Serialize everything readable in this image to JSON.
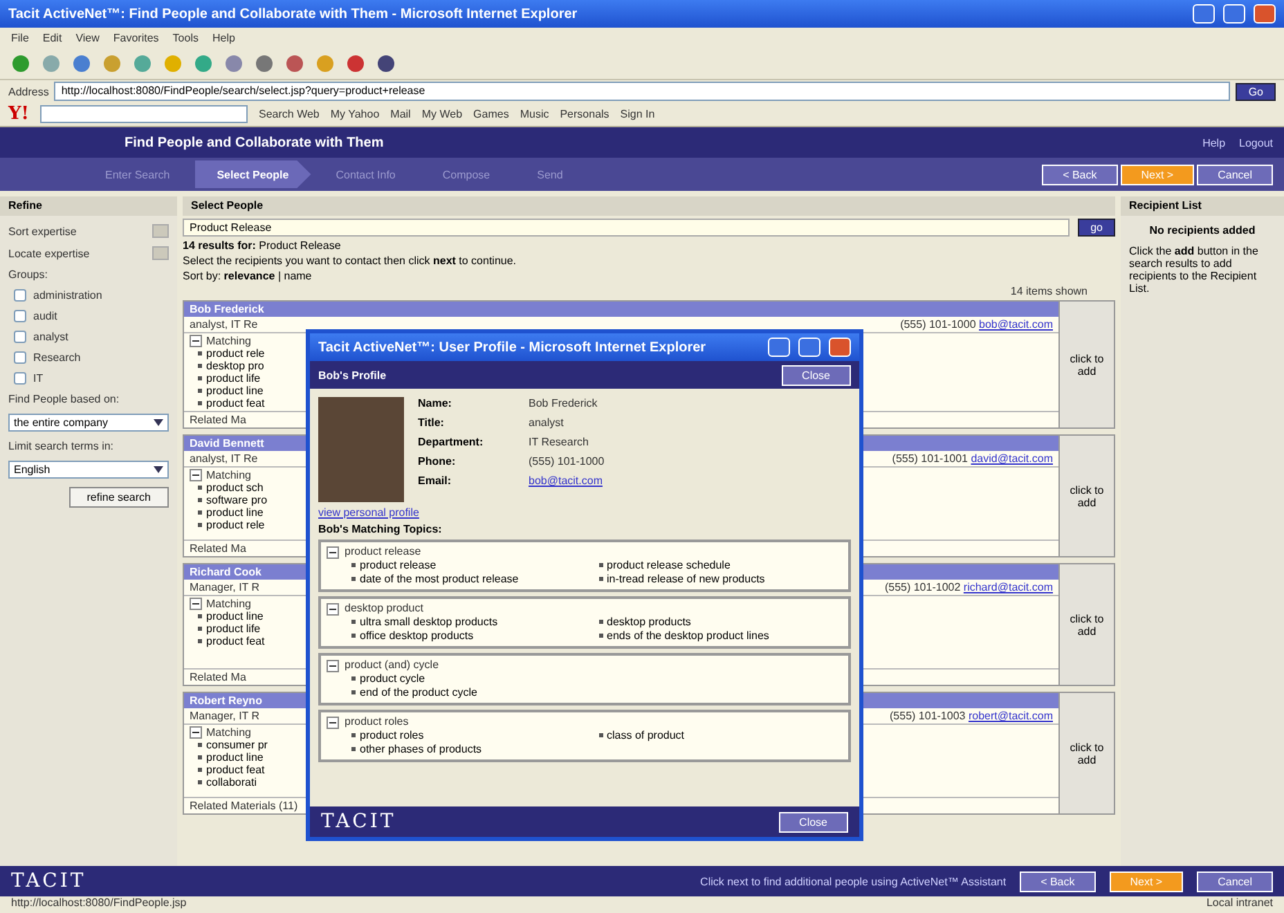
{
  "window": {
    "title": "Tacit ActiveNet™: Find People and Collaborate with Them - Microsoft Internet Explorer",
    "menu": [
      "File",
      "Edit",
      "View",
      "Favorites",
      "Tools",
      "Help"
    ],
    "address_label": "Address",
    "address": "http://localhost:8080/FindPeople/search/select.jsp?query=product+release",
    "go": "Go"
  },
  "yahoo_toolbar": {
    "logo": "Y!",
    "search_button": "Search Web",
    "items": [
      "My Yahoo",
      "Mail",
      "My Web",
      "Games",
      "Music",
      "Personals",
      "Sign In"
    ]
  },
  "app_header": {
    "title": "Find People and Collaborate with Them",
    "steps": [
      {
        "label": "Enter Search",
        "selected": false
      },
      {
        "label": "Select People",
        "selected": true
      },
      {
        "label": "Contact Info",
        "selected": false
      },
      {
        "label": "Compose",
        "selected": false
      },
      {
        "label": "Send",
        "selected": false
      }
    ],
    "links": [
      "Help",
      "Logout"
    ],
    "buttons": [
      {
        "label": "< Back",
        "primary": false
      },
      {
        "label": "Next >",
        "primary": true
      },
      {
        "label": "Cancel",
        "primary": false
      }
    ]
  },
  "refine": {
    "title": "Refine",
    "fields": [
      {
        "label": "Sort expertise"
      },
      {
        "label": "Locate expertise"
      }
    ],
    "filter_label": "Groups:",
    "filters": [
      {
        "label": "administration",
        "checked": false
      },
      {
        "label": "audit",
        "checked": false
      },
      {
        "label": "analyst",
        "checked": false
      },
      {
        "label": "Research",
        "checked": false
      },
      {
        "label": "IT",
        "checked": false
      }
    ],
    "people_label": "Find People based on:",
    "people_value": "the entire company",
    "language_label": "Limit search terms in:",
    "language_value": "English",
    "search_button": "refine search"
  },
  "select_people": {
    "title": "Select People",
    "query": "Product Release",
    "go": "go",
    "results": "**14 results for:** Product Release",
    "instruction": "Select the recipients you want to contact then click **next** to continue.",
    "sort": "Sort by: **relevance** | name",
    "shown": "14 items shown",
    "people": [
      {
        "name": "Bob Frederick",
        "line": "analyst, IT Re",
        "phone": "(555) 101-1000",
        "email": "bob@tacit.com",
        "topics_label": "Matching",
        "topics": [
          "product rele",
          "desktop pro",
          "product life",
          "product line",
          "product feat"
        ],
        "more": "Related Ma",
        "add": "click to add"
      },
      {
        "name": "David Bennett",
        "line": "analyst, IT Re",
        "phone": "(555) 101-1001",
        "email": "david@tacit.com",
        "topics_label": "Matching",
        "topics": [
          "product sch",
          "software pro",
          "product line",
          "product rele"
        ],
        "more": "Related Ma",
        "add": "click to add"
      },
      {
        "name": "Richard Cook",
        "line": "Manager, IT R",
        "phone": "(555) 101-1002",
        "email": "richard@tacit.com",
        "topics_label": "Matching",
        "topics": [
          "product line",
          "product life",
          "product feat"
        ],
        "more": "Related Ma",
        "add": "click to add"
      },
      {
        "name": "Robert Reyno",
        "line": "Manager, IT R",
        "phone": "(555) 101-1003",
        "email": "robert@tacit.com",
        "topics_label": "Matching",
        "topics": [
          "consumer pr",
          "product line",
          "product feat",
          "collaborati"
        ],
        "more": "Related Materials (11)",
        "add": "click to add"
      }
    ]
  },
  "recipients": {
    "title": "Recipient List",
    "empty": "No recipients added",
    "hint": "Click the **add** button in the search results to add recipients to the Recipient List."
  },
  "footer": {
    "logo": "TACIT",
    "note": "Click next to find additional people using ActiveNet™ Assistant",
    "buttons": [
      {
        "label": "< Back",
        "primary": false
      },
      {
        "label": "Next >",
        "primary": true
      },
      {
        "label": "Cancel",
        "primary": false
      }
    ]
  },
  "status_bar": {
    "url": "http://localhost:8080/FindPeople.jsp",
    "zone": "Local intranet"
  },
  "popup": {
    "title": "Tacit ActiveNet™: User Profile - Microsoft Internet Explorer",
    "header": "Bob's Profile",
    "close_top": "Close",
    "close_bottom": "Close",
    "fields": [
      {
        "label": "Name:",
        "value": "Bob Frederick",
        "kind": "text"
      },
      {
        "label": "Title:",
        "value": "analyst",
        "kind": "text"
      },
      {
        "label": "Department:",
        "value": "IT Research",
        "kind": "text"
      },
      {
        "label": "Phone:",
        "value": "(555) 101-1000",
        "kind": "text"
      },
      {
        "label": "Email:",
        "value": "bob@tacit.com",
        "kind": "link"
      }
    ],
    "profile_link": "view personal profile",
    "topics_title": "Bob's Matching Topics:",
    "topics": [
      {
        "name": "product release",
        "expanded": true,
        "items": [
          "product release",
          "date of the most product release",
          "product release schedule",
          "in-tread release of new products"
        ]
      },
      {
        "name": "desktop product",
        "expanded": true,
        "items": [
          "ultra small desktop products",
          "office desktop products",
          "desktop products",
          "ends of the desktop product lines"
        ]
      },
      {
        "name": "product (and) cycle",
        "expanded": true,
        "items": [
          "product cycle",
          "end of the product cycle"
        ]
      },
      {
        "name": "product roles",
        "expanded": true,
        "items": [
          "product roles",
          "other phases of products",
          "class of product"
        ]
      }
    ],
    "logo": "TACIT"
  }
}
